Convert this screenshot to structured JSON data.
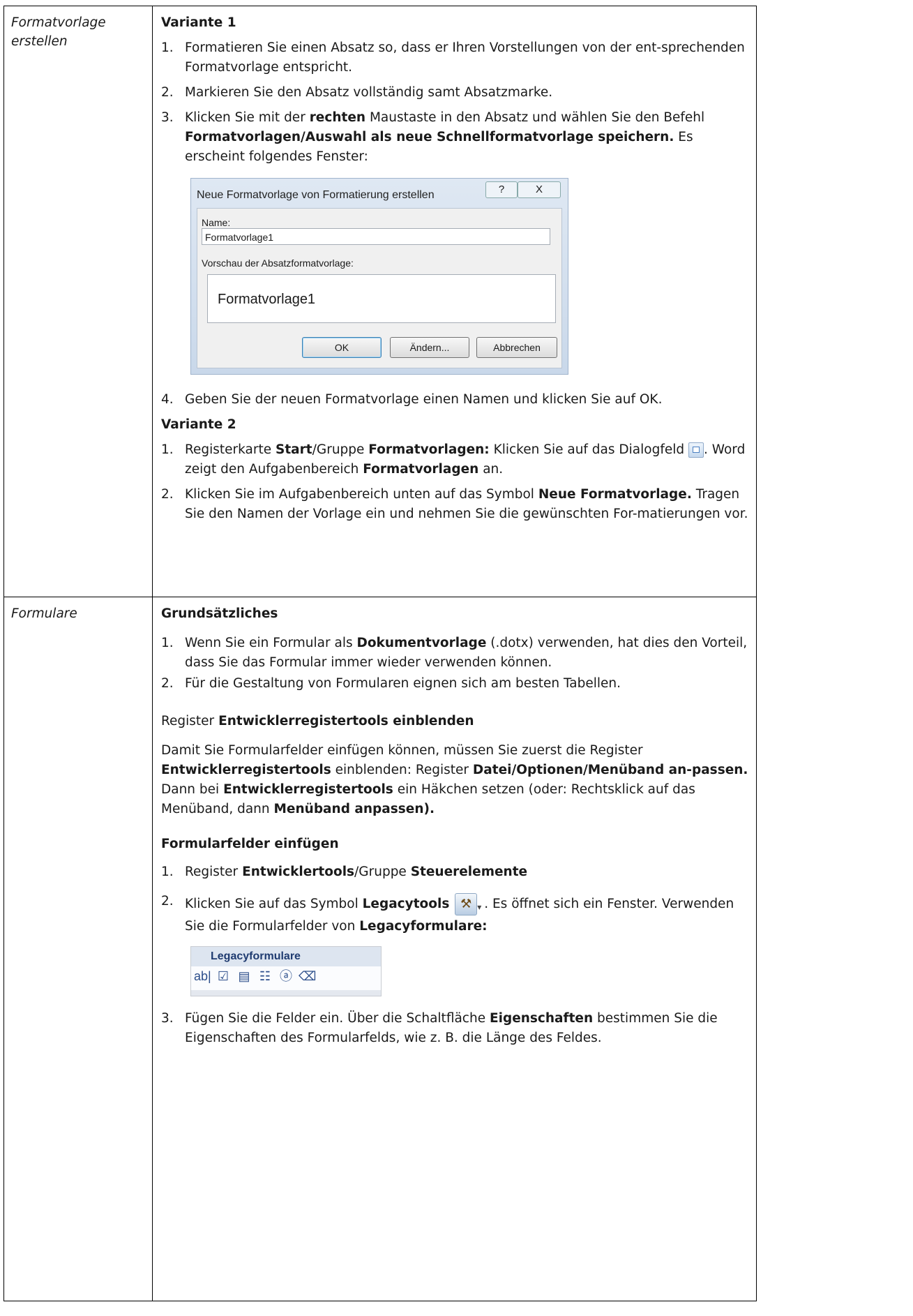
{
  "section1": {
    "term_line1": "Formatvorlage",
    "term_line2": "erstellen",
    "v1_heading": "Variante 1",
    "v1_items": [
      {
        "num": "1.",
        "text": "Formatieren Sie einen Absatz so, dass er Ihren Vorstellungen von der ent-sprechenden Formatvorlage entspricht."
      },
      {
        "num": "2.",
        "text": "Markieren Sie den Absatz vollständig samt Absatzmarke."
      },
      {
        "num": "3.",
        "a": "Klicken Sie mit der ",
        "b1": "rechten",
        "c": " Maustaste in den Absatz und wählen Sie den Befehl ",
        "b2": "Formatvorlagen/Auswahl als neue Schnellformatvorlage speichern.",
        "d": " Es erscheint folgendes Fenster:"
      },
      {
        "num": "4.",
        "text": "Geben Sie der neuen Formatvorlage einen Namen und klicken Sie auf OK."
      }
    ],
    "dialog": {
      "title": "Neue Formatvorlage von Formatierung erstellen",
      "help": "?",
      "close": "X",
      "name_label": "Name:",
      "name_value": "Formatvorlage1",
      "preview_label": "Vorschau der Absatzformatvorlage:",
      "preview_text": "Formatvorlage1",
      "ok": "OK",
      "change": "Ändern...",
      "cancel": "Abbrechen"
    },
    "v2_heading": "Variante 2",
    "v2_item1": {
      "num": "1.",
      "a": "Registerkarte ",
      "b1": "Start",
      "c": "/Gruppe ",
      "b2": "Formatvorlagen:",
      "d": " Klicken Sie auf das Dialogfeld ",
      "e": ". Word zeigt den Aufgabenbereich ",
      "b3": "Formatvorlagen",
      "f": " an."
    },
    "v2_item2": {
      "num": "2.",
      "a": "Klicken Sie im Aufgabenbereich unten auf das Symbol ",
      "b1": "Neue Formatvorlage.",
      "c": " Tragen Sie den Namen der Vorlage ein und nehmen Sie die gewünschten For-matierungen vor."
    }
  },
  "section2": {
    "term": "Formulare",
    "h1": "Grundsätzliches",
    "g1": {
      "num": "1.",
      "a": "Wenn Sie ein Formular als ",
      "b1": "Dokumentvorlage",
      "c": " (.dotx) verwenden, hat dies den Vorteil, dass Sie das Formular immer wieder verwenden können."
    },
    "g2": {
      "num": "2.",
      "text": "Für die Gestaltung von Formularen eignen sich am besten Tabellen."
    },
    "reg_a": "Register ",
    "reg_b": "Entwicklerregistertools einblenden",
    "p": {
      "a": "Damit Sie Formularfelder einfügen können, müssen Sie zuerst die Register ",
      "b1": "Entwicklerregistertools",
      "c": " einblenden: Register ",
      "b2": "Datei/Optionen/Menüband an-passen.",
      "d": " Dann bei ",
      "b3": "Entwicklerregistertools",
      "e": " ein Häkchen setzen (oder: Rechtsklick auf das Menüband, dann ",
      "b4": "Menüband anpassen).",
      "f": ""
    },
    "h2": "Formularfelder einfügen",
    "f1": {
      "num": "1.",
      "a": "Register ",
      "b1": "Entwicklertools",
      "c": "/Gruppe ",
      "b2": "Steuerelemente"
    },
    "f2": {
      "num": "2.",
      "a": "Klicken Sie auf das Symbol ",
      "b1": "Legacytools",
      "c": ". Es öffnet sich ein Fenster. Verwenden Sie die Formularfelder von ",
      "b2": "Legacyformulare:"
    },
    "legacy": {
      "header": "Legacyformulare",
      "icons": [
        "ab|",
        "☑",
        "▤",
        "☷",
        "ⓐ",
        "⌫"
      ]
    },
    "f3": {
      "num": "3.",
      "a": "Fügen Sie die Felder ein. Über die Schaltfläche ",
      "b1": "Eigenschaften",
      "c": " bestimmen Sie die Eigenschaften des Formularfelds, wie z. B. die Länge des Feldes."
    }
  }
}
